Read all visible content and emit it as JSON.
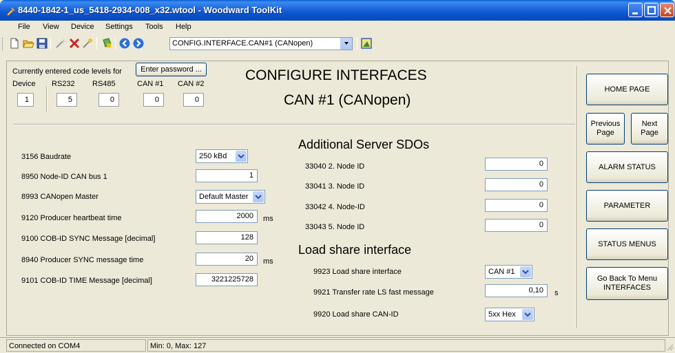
{
  "window": {
    "title": "8440-1842-1_us_5418-2934-008_x32.wtool - Woodward ToolKit"
  },
  "menu": [
    "File",
    "View",
    "Device",
    "Settings",
    "Tools",
    "Help"
  ],
  "toolbar": {
    "page_combo": "CONFIG.INTERFACE.CAN#1 (CANopen)"
  },
  "code_levels": {
    "caption": "Currently entered code levels for",
    "password_button": "Enter password ...",
    "columns": [
      {
        "label": "Device",
        "value": "1"
      },
      {
        "label": "RS232",
        "value": "5"
      },
      {
        "label": "RS485",
        "value": "0"
      },
      {
        "label": "CAN #1",
        "value": "0"
      },
      {
        "label": "CAN #2",
        "value": "0"
      }
    ]
  },
  "page": {
    "title": "CONFIGURE INTERFACES",
    "subtitle": "CAN #1 (CANopen)"
  },
  "left_params": [
    {
      "label": "3156 Baudrate",
      "value": "250 kBd",
      "kind": "select"
    },
    {
      "label": "8950 Node-ID CAN bus 1",
      "value": "1",
      "kind": "field"
    },
    {
      "label": "8993 CANopen Master",
      "value": "Default Master",
      "kind": "select"
    },
    {
      "label": "9120 Producer heartbeat time",
      "value": "2000",
      "unit": "ms",
      "kind": "field"
    },
    {
      "label": "9100 COB-ID SYNC Message [decimal]",
      "value": "128",
      "kind": "field"
    },
    {
      "label": "8940 Producer SYNC message time",
      "value": "20",
      "unit": "ms",
      "kind": "field"
    },
    {
      "label": "9101 COB-ID TIME Message [decimal]",
      "value": "3221225728",
      "kind": "field"
    }
  ],
  "sdo_section": {
    "title": "Additional Server SDOs",
    "items": [
      {
        "label": "33040 2. Node ID",
        "value": "0"
      },
      {
        "label": "33041 3. Node ID",
        "value": "0"
      },
      {
        "label": "33042 4. Node-ID",
        "value": "0"
      },
      {
        "label": "33043 5. Node ID",
        "value": "0"
      }
    ]
  },
  "loadshare_section": {
    "title": "Load share interface",
    "items": [
      {
        "label": "9923 Load share interface",
        "value": "CAN #1",
        "kind": "select"
      },
      {
        "label": "9921 Transfer rate LS fast message",
        "value": "0,10",
        "unit": "s",
        "kind": "field"
      },
      {
        "label": "9920 Load share CAN-ID",
        "value": "5xx Hex",
        "kind": "select"
      }
    ]
  },
  "nav": {
    "home": "HOME PAGE",
    "previous": "Previous Page",
    "next": "Next Page",
    "alarm": "ALARM STATUS",
    "parameter": "PARAMETER",
    "status_menus": "STATUS MENUS",
    "go_back": "Go Back To Menu INTERFACES"
  },
  "status": {
    "connection": "Connected on COM4",
    "range": "Min: 0, Max: 127"
  },
  "colors": {
    "titlebar": "#0a52cc",
    "face": "#ece9d8"
  }
}
